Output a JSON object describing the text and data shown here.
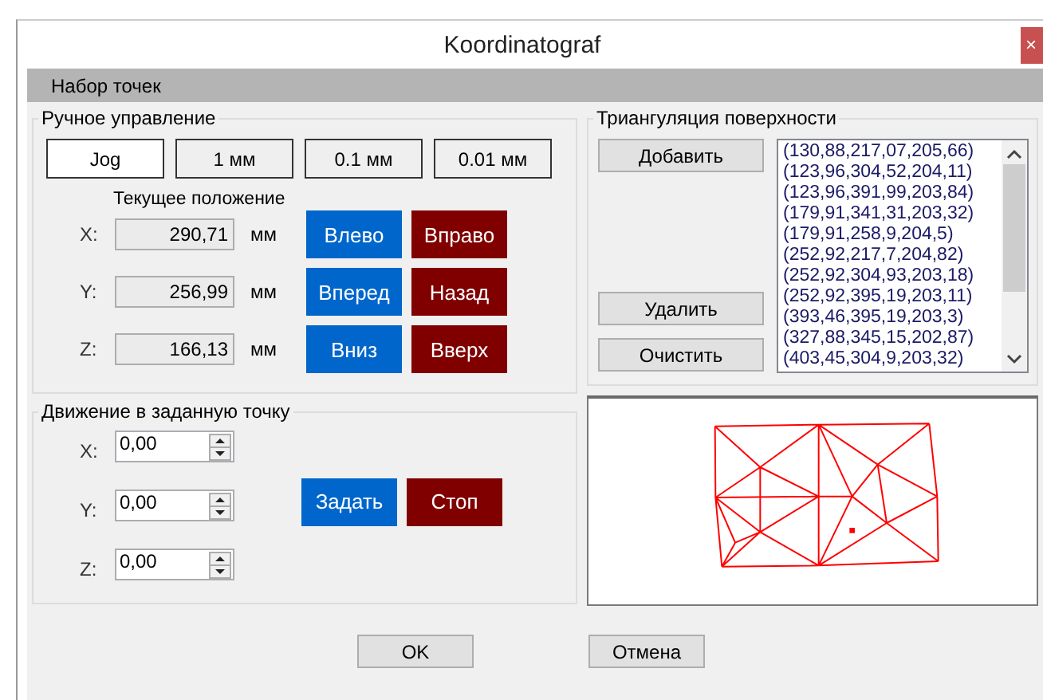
{
  "window": {
    "title": "Koordinatograf",
    "close": "×"
  },
  "header": "Набор точек",
  "manual": {
    "title": "Ручное управление",
    "steps": [
      {
        "label": "Jog",
        "selected": true
      },
      {
        "label": "1 мм",
        "selected": false
      },
      {
        "label": "0.1 мм",
        "selected": false
      },
      {
        "label": "0.01 мм",
        "selected": false
      }
    ],
    "position_caption": "Текущее положение",
    "axes": [
      {
        "label": "X:",
        "value": "290,71",
        "unit": "мм",
        "minus": "Влево",
        "plus": "Вправо"
      },
      {
        "label": "Y:",
        "value": "256,99",
        "unit": "мм",
        "minus": "Вперед",
        "plus": "Назад"
      },
      {
        "label": "Z:",
        "value": "166,13",
        "unit": "мм",
        "minus": "Вниз",
        "plus": "Вверх"
      }
    ]
  },
  "triangulation": {
    "title": "Триангуляция поверхности",
    "add": "Добавить",
    "remove": "Удалить",
    "clear": "Очистить",
    "points": [
      "(130,88,217,07,205,66)",
      "(123,96,304,52,204,11)",
      "(123,96,391,99,203,84)",
      "(179,91,341,31,203,32)",
      "(179,91,258,9,204,5)",
      "(252,92,217,7,204,82)",
      "(252,92,304,93,203,18)",
      "(252,92,395,19,203,11)",
      "(393,46,395,19,203,3)",
      "(327,88,345,15,202,87)",
      "(403,45,304,9,203,32)"
    ]
  },
  "goto": {
    "title": "Движение в заданную точку",
    "axes": [
      {
        "label": "X:",
        "value": "0,00"
      },
      {
        "label": "Y:",
        "value": "0,00"
      },
      {
        "label": "Z:",
        "value": "0,00"
      }
    ],
    "buttons": [
      {
        "label": "Задать",
        "kind": "start"
      },
      {
        "label": "Стоп",
        "kind": "stop"
      }
    ]
  },
  "footer": {
    "buttons": [
      "OK",
      "Отмена"
    ]
  }
}
